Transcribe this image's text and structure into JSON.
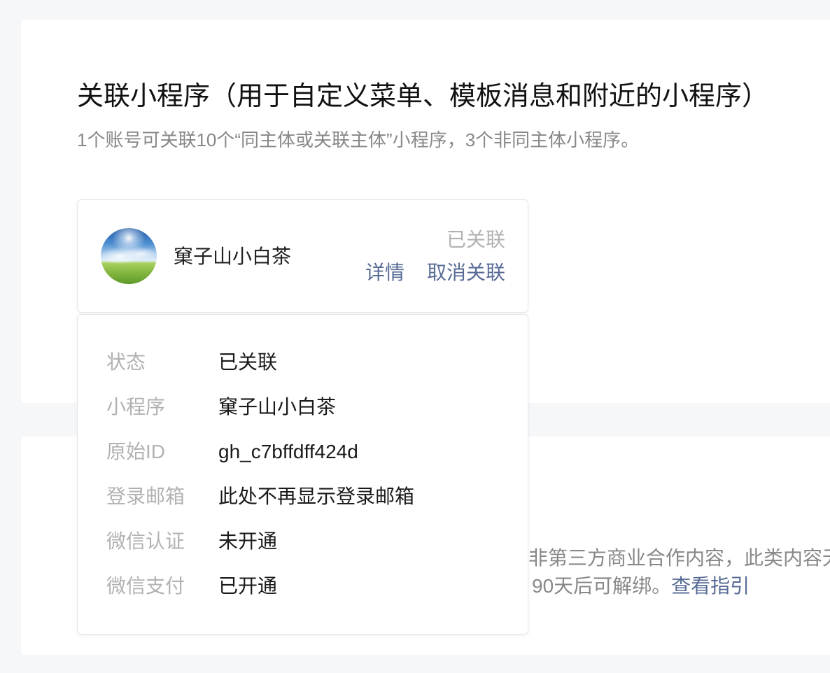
{
  "header": {
    "title": "关联小程序（用于自定义菜单、模板消息和附近的小程序）",
    "subtitle": "1个账号可关联10个“同主体或关联主体”小程序，3个非同主体小程序。"
  },
  "mini_program_card": {
    "name": "窠子山小白茶",
    "status": "已关联",
    "details_link": "详情",
    "unlink_link": "取消关联"
  },
  "details_popup": {
    "rows": [
      {
        "label": "状态",
        "value": "已关联"
      },
      {
        "label": "小程序",
        "value": "窠子山小白茶"
      },
      {
        "label": "原始ID",
        "value": "gh_c7bffdff424d"
      },
      {
        "label": "登录邮箱",
        "value": "此处不再显示登录邮箱"
      },
      {
        "label": "微信认证",
        "value": "未开通"
      },
      {
        "label": "微信支付",
        "value": "已开通"
      }
    ]
  },
  "lower_section": {
    "line1": "非第三方商业合作内容，此类内容无",
    "line2": "90天后可解绑。",
    "guide_link": "查看指引"
  },
  "colors": {
    "page_background": "#f6f7f9",
    "link": "#576b95",
    "label": "#b2b2b2",
    "muted_text": "#888888",
    "border": "#e3e6ea"
  }
}
